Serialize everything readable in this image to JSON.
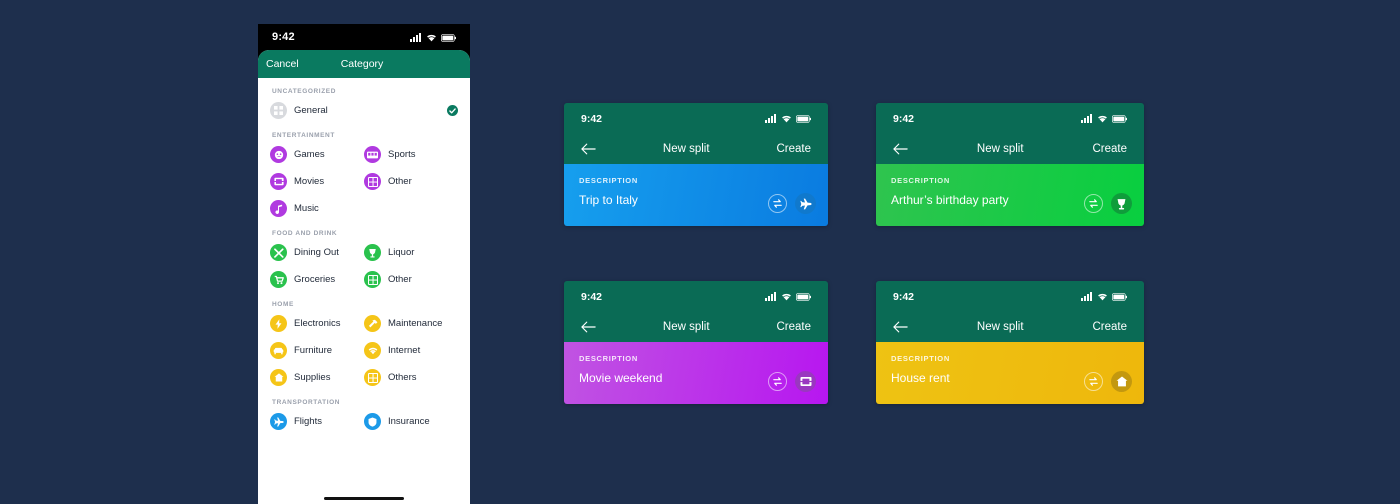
{
  "background_color": "#1e2f4d",
  "phone": {
    "status_bar": {
      "time": "9:42",
      "icons": [
        "signal-icon",
        "wifi-icon",
        "battery-icon"
      ]
    },
    "nav": {
      "cancel_label": "Cancel",
      "title": "Category",
      "bar_color": "#0a7a60"
    },
    "sections": [
      {
        "label": "UNCATEGORIZED",
        "items": [
          {
            "label": "General",
            "icon": "grid-icon",
            "color": "#d8dade",
            "selected": true,
            "full_width": true
          }
        ]
      },
      {
        "label": "ENTERTAINMENT",
        "color": "#b03ae0",
        "items": [
          {
            "label": "Games",
            "icon": "gamepad-icon"
          },
          {
            "label": "Sports",
            "icon": "scoreboard-icon"
          },
          {
            "label": "Movies",
            "icon": "film-icon"
          },
          {
            "label": "Other",
            "icon": "grid-icon"
          },
          {
            "label": "Music",
            "icon": "music-note-icon"
          }
        ]
      },
      {
        "label": "FOOD AND DRINK",
        "color": "#2ac24d",
        "items": [
          {
            "label": "Dining Out",
            "icon": "cutlery-icon"
          },
          {
            "label": "Liquor",
            "icon": "wine-glass-icon"
          },
          {
            "label": "Groceries",
            "icon": "shopping-cart-icon"
          },
          {
            "label": "Other",
            "icon": "grid-icon"
          }
        ]
      },
      {
        "label": "HOME",
        "color": "#f5c518",
        "items": [
          {
            "label": "Electronics",
            "icon": "bolt-icon"
          },
          {
            "label": "Maintenance",
            "icon": "hammer-icon"
          },
          {
            "label": "Furniture",
            "icon": "sofa-icon"
          },
          {
            "label": "Internet",
            "icon": "wifi-icon"
          },
          {
            "label": "Supplies",
            "icon": "house-icon"
          },
          {
            "label": "Others",
            "icon": "grid-icon"
          }
        ]
      },
      {
        "label": "TRANSPORTATION",
        "color": "#1c9ae8",
        "items": [
          {
            "label": "Flights",
            "icon": "airplane-icon"
          },
          {
            "label": "Insurance",
            "icon": "shield-icon"
          }
        ]
      }
    ]
  },
  "cards": [
    {
      "status_bar": {
        "time": "9:42"
      },
      "nav": {
        "back": "back-arrow-icon",
        "title": "New split",
        "create_label": "Create"
      },
      "body": {
        "description_label": "DESCRIPTION",
        "title": "Trip to Italy",
        "swap_icon": "swap-icon",
        "category_icon": "airplane-icon",
        "color_start": "#169fee",
        "color_end": "#0a7be0",
        "badge_color": "#1079cd"
      }
    },
    {
      "status_bar": {
        "time": "9:42"
      },
      "nav": {
        "back": "back-arrow-icon",
        "title": "New split",
        "create_label": "Create"
      },
      "body": {
        "description_label": "DESCRIPTION",
        "title": "Arthur’s birthday party",
        "swap_icon": "swap-icon",
        "category_icon": "wine-glass-icon",
        "color_start": "#2fc44f",
        "color_end": "#08cf3f",
        "badge_color": "#0f9d3b"
      }
    },
    {
      "status_bar": {
        "time": "9:42"
      },
      "nav": {
        "back": "back-arrow-icon",
        "title": "New split",
        "create_label": "Create"
      },
      "body": {
        "description_label": "DESCRIPTION",
        "title": "Movie weekend",
        "swap_icon": "swap-icon",
        "category_icon": "film-icon",
        "color_start": "#c054e2",
        "color_end": "#b716f0",
        "badge_color": "#9a37c0"
      }
    },
    {
      "status_bar": {
        "time": "9:42"
      },
      "nav": {
        "back": "back-arrow-icon",
        "title": "New split",
        "create_label": "Create"
      },
      "body": {
        "description_label": "DESCRIPTION",
        "title": "House rent",
        "swap_icon": "swap-icon",
        "category_icon": "house-icon",
        "color_start": "#eec313",
        "color_end": "#eeb70c",
        "badge_color": "#c3980f"
      }
    }
  ]
}
